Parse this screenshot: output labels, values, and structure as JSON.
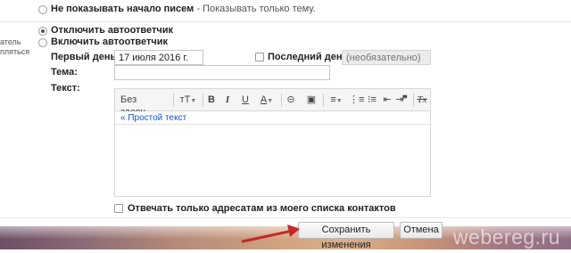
{
  "settings": {
    "snippet_option_label": "Не показывать начало писем",
    "snippet_option_hint": " - Показывать только тему.",
    "side_label_line1": "атель",
    "side_label_line2": "пляться"
  },
  "autoreply": {
    "off_label": "Отключить автоответчик",
    "on_label": "Включить автоответчик",
    "first_day_label": "Первый день:",
    "first_day_value": "17 июля 2016 г.",
    "last_day_label": "Последний день:",
    "last_day_placeholder": "(необязательно)",
    "subject_label": "Тема:",
    "subject_value": "",
    "text_label": "Текст:",
    "contacts_only_label": "Отвечать только адресатам из моего списка контактов"
  },
  "toolbar": {
    "font_label": "Без засеч...",
    "size_label": "тТ",
    "bold_label": "B",
    "italic_label": "I",
    "underline_label": "U",
    "color_label": "A",
    "link_label": "⊝",
    "image_label": "▣",
    "align_label": "≡",
    "numbered_list_label": "⋮≡",
    "bulleted_list_label": "⁝≡",
    "indent_less_label": "⇤",
    "indent_more_label": "⇥",
    "quote_label": "❞",
    "clear_format_label": "Tx"
  },
  "editor": {
    "plain_text_link": "« Простой текст"
  },
  "actions": {
    "save_label": "Сохранить изменения",
    "cancel_label": "Отмена"
  },
  "watermark": "webereg.ru",
  "colors": {
    "link": "#1155cc",
    "arrow": "#c62828"
  }
}
